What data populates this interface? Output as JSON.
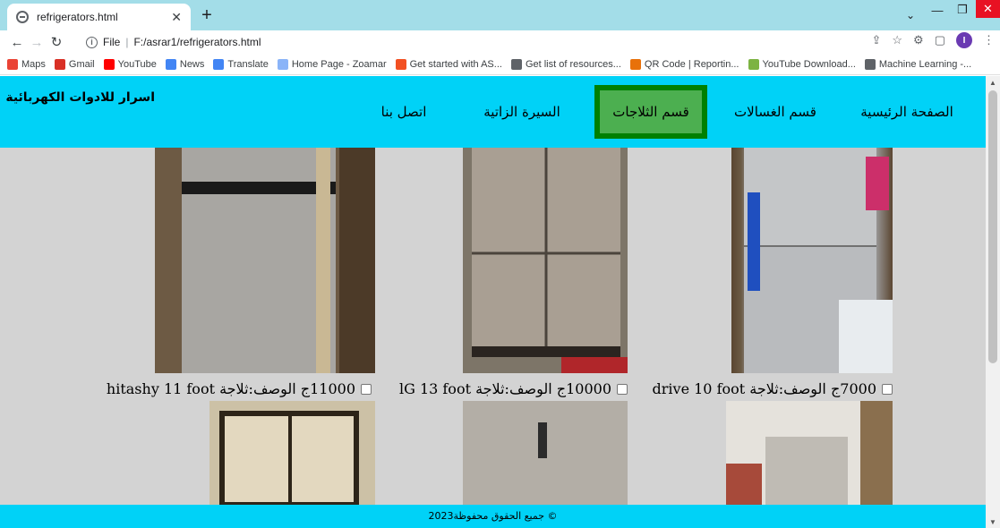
{
  "browser": {
    "tab_title": "refrigerators.html",
    "address_scheme": "File",
    "address_path": "F:/asrar1/refrigerators.html",
    "bookmarks": [
      {
        "label": "Maps",
        "icon": "maps-pin-icon",
        "color": "#ea4335"
      },
      {
        "label": "Gmail",
        "icon": "gmail-icon",
        "color": "#d93025"
      },
      {
        "label": "YouTube",
        "icon": "youtube-icon",
        "color": "#ff0000"
      },
      {
        "label": "News",
        "icon": "news-icon",
        "color": "#4285f4"
      },
      {
        "label": "Translate",
        "icon": "translate-icon",
        "color": "#4285f4"
      },
      {
        "label": "Home Page - Zoamar",
        "icon": "page-icon",
        "color": "#8ab4f8"
      },
      {
        "label": "Get started with AS...",
        "icon": "microsoft-icon",
        "color": "#f25022"
      },
      {
        "label": "Get list of resources...",
        "icon": "globe-icon",
        "color": "#5f6368"
      },
      {
        "label": "QR Code | Reportin...",
        "icon": "qr-icon",
        "color": "#e8710a"
      },
      {
        "label": "YouTube Download...",
        "icon": "download-icon",
        "color": "#7cb342"
      },
      {
        "label": "Machine Learning -...",
        "icon": "ml-icon",
        "color": "#5f6368"
      }
    ]
  },
  "site": {
    "brand": "اسرار للادوات الكهربائية",
    "nav": [
      {
        "label": "الصفحة الرئيسية",
        "active": false
      },
      {
        "label": "قسم الغسالات",
        "active": false
      },
      {
        "label": "قسم الثلاجات",
        "active": true
      },
      {
        "label": "السيرة الزاتية",
        "active": false
      },
      {
        "label": "اتصل بنا",
        "active": false
      }
    ],
    "products_row1": [
      {
        "caption": "7000ج الوصف:ثلاجة drive 10 foot"
      },
      {
        "caption": "10000ج الوصف:ثلاجة lG 13 foot"
      },
      {
        "caption": "11000ج الوصف:ثلاجة hitashy 11 foot"
      }
    ],
    "footer": "© جميع الحقوق محفوظة2023"
  },
  "colors": {
    "navbar": "#00d2f7",
    "active_nav_bg": "#4caf50",
    "active_nav_border": "#008000",
    "page_bg": "#d3d3d3"
  }
}
